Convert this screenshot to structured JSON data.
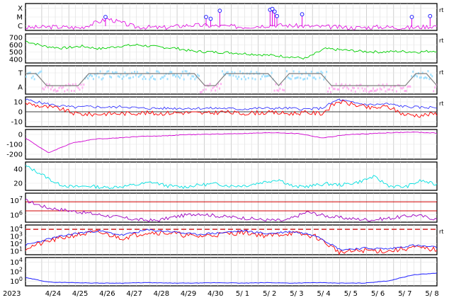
{
  "chart_data": {
    "type": "line",
    "x_axis": {
      "year_label": "2023",
      "labels": [
        "4/24",
        "4/25",
        "4/26",
        "4/27",
        "4/28",
        "4/29",
        "4/30",
        "5/ 1",
        "5/ 2",
        "5/ 3",
        "5/ 4",
        "5/ 5",
        "5/ 6",
        "5/ 7",
        "5/ 8"
      ],
      "range_days": [
        -0.6,
        14.6
      ]
    },
    "panels": [
      {
        "id": "flare",
        "type": "scatter",
        "ytick_labels": [
          "X",
          "M",
          "C"
        ],
        "ylim": [
          0,
          3
        ],
        "right_mark": "rt",
        "colors": {
          "line": "#e000e0",
          "marker": "#2020ff"
        },
        "series": [
          {
            "values": [
              0.3,
              0.4,
              0.3,
              1.3,
              0.4,
              0.3,
              0.6,
              0.5,
              0.4,
              0.6,
              0.5,
              0.4,
              0.3,
              0.4,
              0.3,
              0.5
            ]
          }
        ],
        "peaks": {
          "x": [
            3.5,
            7.9,
            8.1,
            8.5,
            10.7,
            10.8,
            10.9,
            11.0,
            12.1,
            16.9,
            17.7
          ],
          "y": [
            1.5,
            1.5,
            1.3,
            2.2,
            2.3,
            2.4,
            2.1,
            1.6,
            1.8,
            1.5,
            1.6
          ]
        }
      },
      {
        "id": "velocity",
        "ytick_labels": [
          "700",
          "600",
          "500",
          "400"
        ],
        "ylim": [
          300,
          750
        ],
        "right_mark": "rt",
        "colors": {
          "line": "#00d000"
        },
        "series": [
          {
            "values": [
              640,
              560,
              530,
              560,
              520,
              560,
              580,
              550,
              530,
              480,
              470,
              460,
              440,
              420,
              400,
              370,
              520,
              500,
              480,
              470,
              480,
              470,
              490
            ]
          }
        ]
      },
      {
        "id": "imf-sector",
        "ytick_labels": [
          "T",
          "A"
        ],
        "ylim": [
          0,
          1
        ],
        "right_mark": "rt",
        "colors": {
          "toward": "#a0e0ff",
          "away": "#ffb0f0",
          "line": "#808080"
        },
        "series": [
          {
            "values": [
              1,
              1,
              0,
              0,
              0,
              0,
              1,
              1,
              1,
              1,
              1,
              1,
              1,
              1,
              1,
              1,
              1,
              0,
              0,
              1,
              1,
              1,
              1,
              1,
              0,
              1,
              1,
              1,
              1,
              0,
              0,
              0,
              0,
              0,
              0,
              0,
              0,
              1,
              1,
              0
            ]
          }
        ]
      },
      {
        "id": "bz",
        "ytick_labels": [
          "10",
          "0",
          "-10"
        ],
        "ylim": [
          -17,
          17
        ],
        "right_mark": "rt",
        "colors": {
          "bz": "#ff0000",
          "bt": "#2020ff"
        },
        "series": [
          {
            "values": [
              10,
              6,
              4,
              -2,
              -3,
              -2,
              -2,
              -1,
              -2,
              -1,
              -1,
              -2,
              0,
              -2,
              -1,
              -1,
              -2,
              -1,
              -2,
              12,
              8,
              4,
              6,
              -3,
              -4,
              -2
            ]
          },
          {
            "values": [
              14,
              10,
              7,
              5,
              6,
              5,
              6,
              4,
              4,
              4,
              4,
              4,
              4,
              3,
              4,
              4,
              4,
              3,
              4,
              14,
              10,
              8,
              9,
              6,
              5,
              5
            ]
          }
        ]
      },
      {
        "id": "dst",
        "ytick_labels": [
          "0",
          "-100",
          "-200"
        ],
        "ylim": [
          -260,
          20
        ],
        "right_mark": "",
        "colors": {
          "line": "#d000d0"
        },
        "series": [
          {
            "values": [
              -60,
              -200,
              -110,
              -70,
              -60,
              -45,
              -40,
              -30,
              -25,
              -20,
              -15,
              -10,
              -20,
              -60,
              -30,
              -20,
              -10,
              -5,
              -15
            ]
          }
        ]
      },
      {
        "id": "kp",
        "ytick_labels": [
          "40",
          "20"
        ],
        "ylim": [
          0,
          52
        ],
        "right_mark": "",
        "colors": {
          "line": "#00e0e0"
        },
        "series": [
          {
            "values": [
              45,
              30,
              12,
              6,
              8,
              5,
              7,
              10,
              15,
              8,
              6,
              10,
              12,
              8,
              9,
              15,
              20,
              6,
              8,
              12,
              10,
              15,
              25,
              8,
              6,
              18,
              10
            ]
          }
        ]
      },
      {
        "id": "proton",
        "ytick_labels": [
          "10^7",
          "10^6"
        ],
        "ylim": [
          0,
          10
        ],
        "right_mark": "",
        "colors": {
          "threshold": "#d00000",
          "line": "#a000c0"
        },
        "thresholds": [
          7,
          3.9
        ],
        "series": [
          {
            "values": [
              7.5,
              5,
              4,
              3,
              2,
              1,
              0.5,
              2,
              3,
              2,
              1.5,
              0.8,
              0.5,
              3.5,
              2,
              1.2,
              0.8,
              1.5,
              2.5,
              1
            ]
          }
        ]
      },
      {
        "id": "xray",
        "ytick_labels": [
          "10^4",
          "10^3",
          "10^2",
          "10^1"
        ],
        "ylim": [
          0.5,
          4.6
        ],
        "right_mark": "rt",
        "colors": {
          "threshold": "#d00000",
          "blue": "#2020ff",
          "red": "#ff0000"
        },
        "threshold": 4.0,
        "series": [
          {
            "values": [
              1.8,
              2.7,
              3.4,
              3.8,
              3.2,
              3.9,
              3.7,
              3.3,
              3.5,
              3.8,
              3.4,
              3.7,
              3.2,
              1.2,
              1.4,
              1.3,
              1.8,
              1.5
            ]
          },
          {
            "values": [
              1.4,
              2.4,
              3.2,
              3.6,
              2.8,
              3.6,
              3.5,
              3.0,
              3.3,
              3.6,
              3.1,
              3.5,
              3.0,
              0.8,
              1.1,
              1.0,
              1.5,
              1.2
            ]
          }
        ]
      },
      {
        "id": "electron",
        "ytick_labels": [
          "10^4",
          "10^2",
          "10^0"
        ],
        "ylim": [
          -1.6,
          4.6
        ],
        "right_mark": "",
        "colors": {
          "line": "#2020ff"
        },
        "series": [
          {
            "values": [
              0.2,
              -0.8,
              -0.9,
              -1.0,
              -1.0,
              -0.9,
              -1.0,
              -1.0,
              -0.9,
              -1.0,
              -0.9,
              -1.0,
              -0.9,
              -1.0,
              -1.0,
              -0.5,
              0.8,
              1.2
            ]
          }
        ]
      }
    ]
  }
}
